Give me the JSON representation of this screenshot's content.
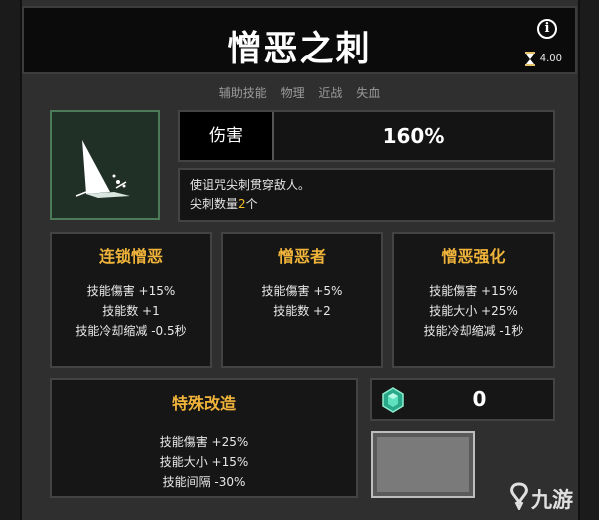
{
  "skill": {
    "title": "憎恶之刺",
    "cooldown": "4.00",
    "tags": [
      "辅助技能",
      "物理",
      "近战",
      "失血"
    ],
    "damage_label": "伤害",
    "damage_value": "160%",
    "description_line1": "使诅咒尖刺贯穿敌人。",
    "description_line2_prefix": "尖刺数量",
    "description_line2_value": "2",
    "description_line2_suffix": "个"
  },
  "upgrades": [
    {
      "title": "连锁憎恶",
      "stats": [
        "技能傷害 +15%",
        "技能数 +1",
        "技能冷却缩减 -0.5秒"
      ]
    },
    {
      "title": "憎恶者",
      "stats": [
        "技能傷害 +5%",
        "技能数 +2"
      ]
    },
    {
      "title": "憎恶强化",
      "stats": [
        "技能傷害 +15%",
        "技能大小 +25%",
        "技能冷却缩减 -1秒"
      ]
    },
    {
      "title": "特殊改造",
      "stats": [
        "技能傷害 +25%",
        "技能大小 +15%",
        "技能间隔 -30%"
      ]
    }
  ],
  "currency": {
    "count": "0",
    "icon": "gem-icon"
  },
  "watermark": {
    "text": "九游",
    "icon": "jiuyou-logo"
  },
  "colors": {
    "title_gold": "#f0b43a",
    "highlight": "#f3c02a",
    "icon_bg": "#213027"
  }
}
